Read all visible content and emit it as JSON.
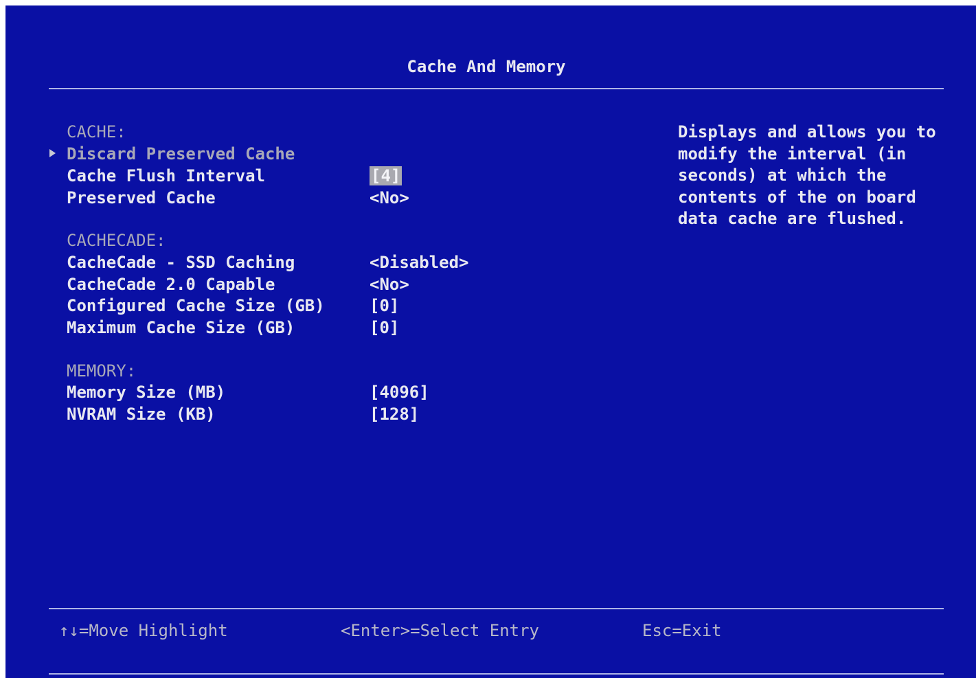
{
  "title": "Cache And Memory",
  "sections": {
    "cache": {
      "heading": "CACHE:",
      "discard_preserved_cache": "Discard Preserved Cache",
      "cache_flush_interval": {
        "label": "Cache Flush Interval",
        "value": "[4]"
      },
      "preserved_cache": {
        "label": "Preserved Cache",
        "value": "<No>"
      }
    },
    "cachecade": {
      "heading": "CACHECADE:",
      "ssd_caching": {
        "label": "CacheCade - SSD Caching",
        "value": "<Disabled>"
      },
      "capable": {
        "label": "CacheCade 2.0 Capable",
        "value": "<No>"
      },
      "configured_size": {
        "label": "Configured Cache Size (GB)",
        "value": "[0]"
      },
      "maximum_size": {
        "label": "Maximum Cache Size (GB)",
        "value": "[0]"
      }
    },
    "memory": {
      "heading": "MEMORY:",
      "memory_size": {
        "label": "Memory Size (MB)",
        "value": "[4096]"
      },
      "nvram_size": {
        "label": "NVRAM Size (KB)",
        "value": "[128]"
      }
    }
  },
  "help": {
    "lines": [
      "Displays and allows you to",
      "modify the interval (in",
      "seconds) at which the",
      "contents of the on board",
      "data cache are flushed."
    ]
  },
  "footer": {
    "move": "↑↓=Move Highlight",
    "select": "<Enter>=Select Entry",
    "exit": "Esc=Exit"
  },
  "colors": {
    "background": "#0a10a4",
    "text": "#e8e8f0",
    "dim_text": "#a8a8b8",
    "highlight": "#a9a9b0"
  }
}
